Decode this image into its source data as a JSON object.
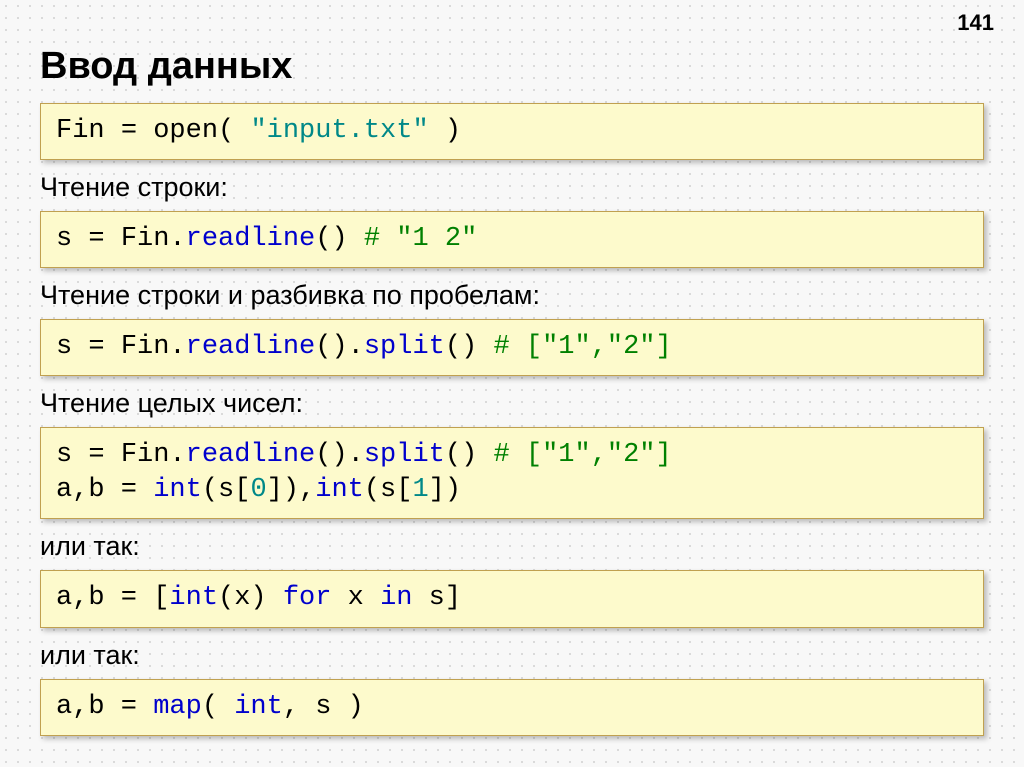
{
  "page_number": "141",
  "title": "Ввод данных",
  "code1": {
    "t1": "Fin ",
    "t2": "=",
    "t3": " open",
    "t4": "( ",
    "t5": "\"input.txt\"",
    "t6": " )"
  },
  "label1": "Чтение строки:",
  "code2": {
    "t1": "s",
    "t2": " = ",
    "t3": "Fin",
    "t4": ".",
    "t5": "readline",
    "t6": "()     ",
    "t7": "# \"1 2\""
  },
  "label2": "Чтение строки и разбивка по пробелам:",
  "code3": {
    "t1": "s",
    "t2": " = ",
    "t3": "Fin",
    "t4": ".",
    "t5": "readline",
    "t6": "().",
    "t7": "split",
    "t8": "()     ",
    "t9": "# [\"1\",\"2\"]"
  },
  "label3": "Чтение целых чисел:",
  "code4": {
    "line1": {
      "t1": "s",
      "t2": " = ",
      "t3": "Fin",
      "t4": ".",
      "t5": "readline",
      "t6": "().",
      "t7": "split",
      "t8": "()     ",
      "t9": "# [\"1\",\"2\"]"
    },
    "line2": {
      "t1": "a,b",
      "t2": " = ",
      "t3": "int",
      "t4": "(s[",
      "t5": "0",
      "t6": "]),",
      "t7": "int",
      "t8": "(s[",
      "t9": "1",
      "t10": "])"
    }
  },
  "label4": "или так:",
  "code5": {
    "t1": "a,b = [",
    "t2": "int",
    "t3": "(x) ",
    "t4": "for",
    "t5": " x ",
    "t6": "in",
    "t7": " s]"
  },
  "label5": "или так:",
  "code6": {
    "t1": "a,b = ",
    "t2": "map",
    "t3": "( ",
    "t4": "int",
    "t5": ", s )"
  }
}
